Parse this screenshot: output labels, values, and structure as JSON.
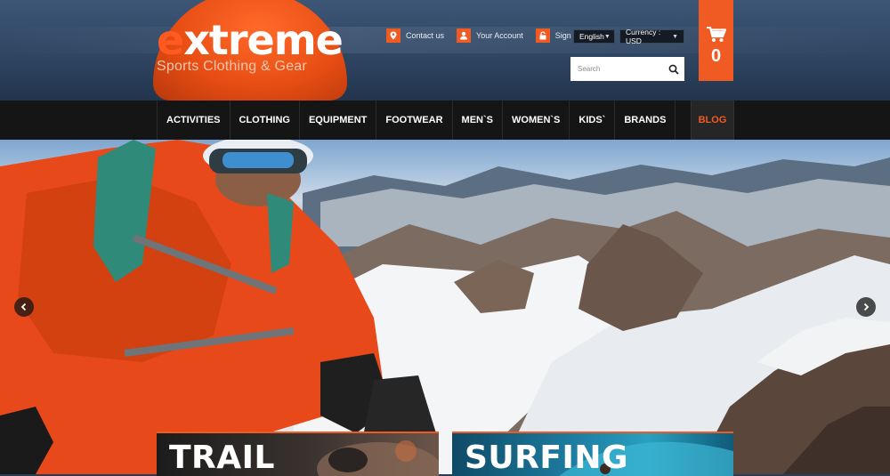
{
  "brand": {
    "logo_first": "e",
    "logo_rest": "xtreme",
    "tagline": "Sports Clothing & Gear"
  },
  "top_links": [
    {
      "label": "Contact us",
      "icon": "map-pin-icon"
    },
    {
      "label": "Your Account",
      "icon": "user-icon"
    },
    {
      "label": "Sign in",
      "icon": "lock-icon"
    }
  ],
  "selectors": {
    "language": "English",
    "currency": "Currency : USD"
  },
  "search": {
    "placeholder": "Search"
  },
  "cart": {
    "count": "0"
  },
  "nav": {
    "items": [
      "ACTIVITIES",
      "CLOTHING",
      "EQUIPMENT",
      "FOOTWEAR",
      "MEN`S",
      "WOMEN`S",
      "KIDS`",
      "BRANDS"
    ],
    "blog": "BLOG"
  },
  "cards": [
    {
      "title": "TRAIL"
    },
    {
      "title": "SURFING"
    }
  ],
  "colors": {
    "accent": "#f05a23",
    "nav_bg": "#151515",
    "header_bg": "#2f4663"
  }
}
